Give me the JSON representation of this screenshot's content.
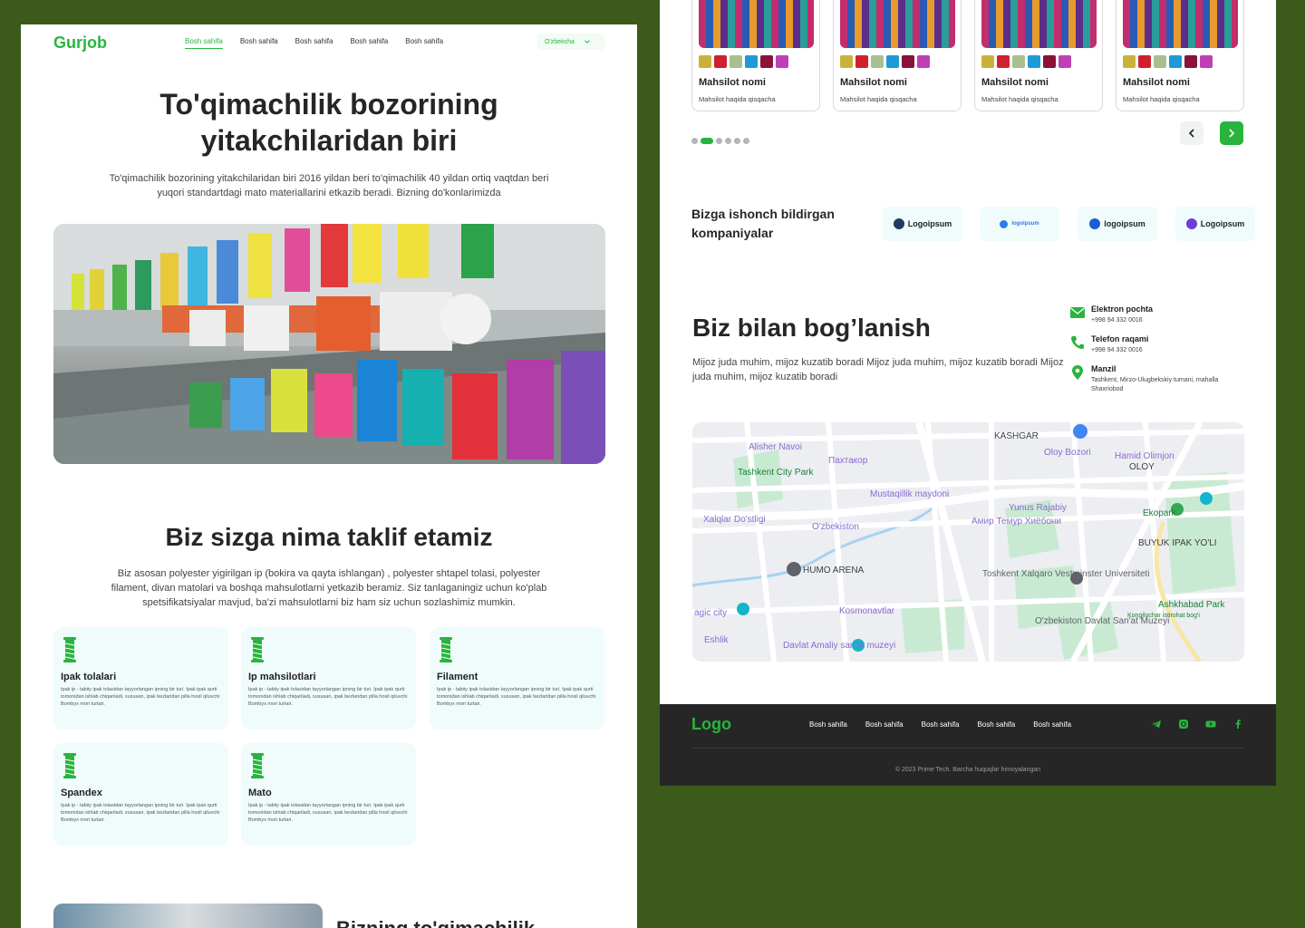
{
  "left_page": {
    "nav": {
      "brand": "Gurjob",
      "links": [
        "Bosh sahifa",
        "Bosh sahifa",
        "Bosh sahifa",
        "Bosh sahifa",
        "Bosh sahifa"
      ],
      "language": "O'zbekcha"
    },
    "hero": {
      "title_line1": "To'qimachilik bozorining",
      "title_line2": "yitakchilaridan biri",
      "subtitle": "To'qimachilik bozorining yitakchilaridan biri 2016 yildan beri to'qimachilik 40 yildan ortiq vaqtdan beri yuqori standartdagi mato materiallarini etkazib beradi. Bizning do'konlarimizda"
    },
    "offer": {
      "title": "Biz sizga nima taklif etamiz",
      "subtitle": "Biz asosan polyester yigirilgan ip (bokira va qayta ishlangan) , polyester shtapel tolasi, polyester filament, divan matolari va boshqa mahsulotlarni yetkazib beramiz. Siz tanlaganingiz uchun ko'plab spetsifikatsiyalar mavjud, ba'zi mahsulotlarni biz ham siz uchun sozlashimiz mumkin.",
      "cards": [
        {
          "title": "Ipak tolalari",
          "desc": "Ipak ip - tabiiy ipak tolasidan tayyorlangan ipning bir turi. Ipak ipak qurti tomonidan ishlab chiqariladi, xususan, ipak bezlaridan pilla hosil qiluvchi Bombyx mori turlari."
        },
        {
          "title": "Ip mahsilotlari",
          "desc": "Ipak ip - tabiiy ipak tolasidan tayyorlangan ipning bir turi. Ipak ipak qurti tomonidan ishlab chiqariladi, xususan, ipak bezlaridan pilla hosil qiluvchi Bombyx mori turlari."
        },
        {
          "title": "Filament",
          "desc": "Ipak ip - tabiiy ipak tolasidan tayyorlangan ipning bir turi. Ipak ipak qurti tomonidan ishlab chiqariladi, xususan, ipak bezlaridan pilla hosil qiluvchi Bombyx mori turlari."
        },
        {
          "title": "Spandex",
          "desc": "Ipak ip - tabiiy ipak tolasidan tayyorlangan ipning bir turi. Ipak ipak qurti tomonidan ishlab chiqariladi, xususan, ipak bezlaridan pilla hosil qiluvchi Bombyx mori turlari."
        },
        {
          "title": "Mato",
          "desc": "Ipak ip - tabiiy ipak tolasidan tayyorlangan ipning bir turi. Ipak ipak qurti tomonidan ishlab chiqariladi, xususan, ipak bezlaridan pilla hosil qiluvchi Bombyx mori turlari."
        }
      ]
    },
    "next_section_title": "Bizning to'qimachilik"
  },
  "right_page": {
    "products": [
      {
        "name": "Mahsilot nomi",
        "desc": "Mahsilot haqida qisqacha"
      },
      {
        "name": "Mahsilot nomi",
        "desc": "Mahsilot haqida qisqacha"
      },
      {
        "name": "Mahsilot nomi",
        "desc": "Mahsilot haqida qisqacha"
      },
      {
        "name": "Mahsilot nomi",
        "desc": "Mahsilot haqida qisqacha"
      }
    ],
    "swatch_colors": [
      "#c9b23a",
      "#d0202e",
      "#a9bf8f",
      "#1e9ad6",
      "#8a1238",
      "#c03fb6"
    ],
    "trust": {
      "title": "Bizga ishonch bildirgan kompaniyalar",
      "logos": [
        "Logoipsum",
        "logoipsum",
        "logoipsum",
        "Logoipsum"
      ],
      "logo_colors": [
        "#1f3a5a",
        "#2b7de9",
        "#1a5bd6",
        "#6b3fd6"
      ]
    },
    "contact": {
      "title": "Biz bilan bog’lanish",
      "subtitle": "Mijoz juda muhim, mijoz kuzatib boradi Mijoz juda muhim, mijoz kuzatib boradi Mijoz juda muhim, mijoz kuzatib boradi",
      "items": [
        {
          "label": "Elektron pochta",
          "value": "+998 94 332 0016",
          "icon": "mail-icon"
        },
        {
          "label": "Telefon raqami",
          "value": "+998 94 332 0016",
          "icon": "phone-icon"
        },
        {
          "label": "Manzil",
          "value": "Tashkent, Mirzo-Ulugbekskiy tumani, mahalla Shaxriobod",
          "icon": "location-icon"
        }
      ]
    },
    "map_labels": [
      "KASHGAR",
      "Oloy Bozori",
      "Hamid Olimjon",
      "OLOY",
      "Alisher Navoi",
      "Пахтакор",
      "Tashkent City Park",
      "Mustaqillik maydoni",
      "Yunus Rajabiy",
      "Амир Темур Хиёбони",
      "Ekopark",
      "Xalqlar Do'stligi",
      "O'zbekiston",
      "BUYUK IPAK YO'LI",
      "HUMO ARENA",
      "Toshkent Xalqaro Vestminster Universiteti",
      "Kosmonavtlar",
      "O'zbekiston Davlat San'at Muzeyi",
      "agic city",
      "Eshlik",
      "Davlat Amaliy san'at muzeyi",
      "Ashkhabad Park",
      "Kongilochar istirohat bog'i"
    ],
    "footer": {
      "logo": "Logo",
      "links": [
        "Bosh sahifa",
        "Bosh sahifa",
        "Bosh sahifa",
        "Bosh sahifa",
        "Bosh sahifa"
      ],
      "copyright": "© 2023 Prime Tech. Barcha huquqlar himoyalangan"
    }
  },
  "colors": {
    "accent": "#28b53d",
    "backdrop": "#3c5a1a",
    "card_bg": "#f0fcfc",
    "footer_bg": "#262626"
  }
}
